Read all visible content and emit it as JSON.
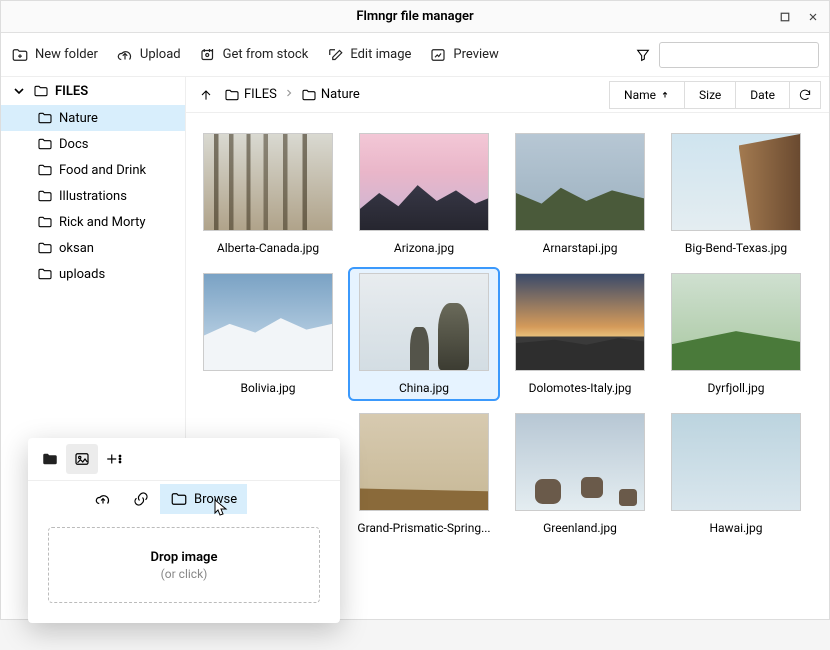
{
  "window": {
    "title": "Flmngr file manager"
  },
  "toolbar": {
    "new_folder": "New folder",
    "upload": "Upload",
    "get_stock": "Get from stock",
    "edit_image": "Edit image",
    "preview": "Preview"
  },
  "sidebar": {
    "root": "FILES",
    "items": [
      {
        "label": "Nature",
        "selected": true
      },
      {
        "label": "Docs",
        "selected": false
      },
      {
        "label": "Food and Drink",
        "selected": false
      },
      {
        "label": "Illustrations",
        "selected": false
      },
      {
        "label": "Rick and Morty",
        "selected": false
      },
      {
        "label": "oksan",
        "selected": false
      },
      {
        "label": "uploads",
        "selected": false
      }
    ]
  },
  "breadcrumb": {
    "root": "FILES",
    "current": "Nature"
  },
  "sort": {
    "name": "Name",
    "size": "Size",
    "date": "Date",
    "active": "name",
    "dir": "asc"
  },
  "files": [
    {
      "name": "Alberta-Canada.jpg",
      "thumb": "t-forest"
    },
    {
      "name": "Arizona.jpg",
      "thumb": "t-arizona"
    },
    {
      "name": "Arnarstapi.jpg",
      "thumb": "t-iceland"
    },
    {
      "name": "Big-Bend-Texas.jpg",
      "thumb": "t-canyon"
    },
    {
      "name": "Bolivia.jpg",
      "thumb": "t-snow"
    },
    {
      "name": "China.jpg",
      "thumb": "t-china",
      "selected": true
    },
    {
      "name": "Dolomotes-Italy.jpg",
      "thumb": "t-sunset"
    },
    {
      "name": "Dyrfjoll.jpg",
      "thumb": "t-green"
    },
    {
      "name": "Grand-Prismatic-Spring...",
      "thumb": "t-spring"
    },
    {
      "name": "Greenland.jpg",
      "thumb": "t-greenland"
    },
    {
      "name": "Hawai.jpg",
      "thumb": "t-hawaii"
    }
  ],
  "popup": {
    "browse": "Browse",
    "drop_title": "Drop image",
    "drop_sub": "(or click)"
  }
}
